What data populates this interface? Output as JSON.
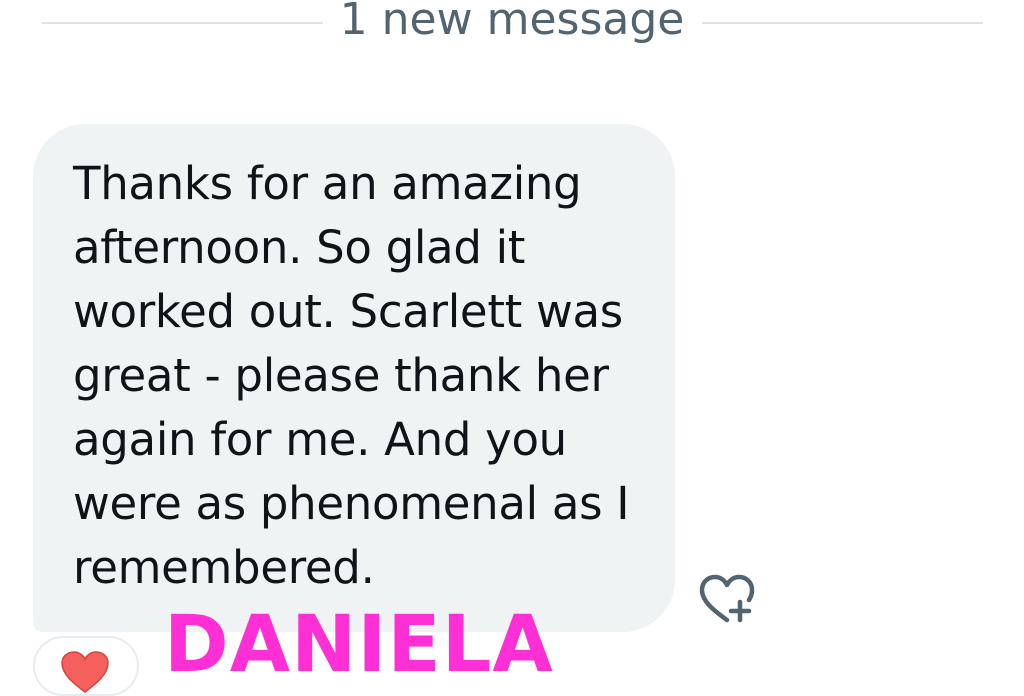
{
  "divider": {
    "label": "1 new message"
  },
  "message": {
    "text": "Thanks for an amazing afternoon. So glad it worked out. Scarlett was great - please thank her again for me. And you were as phenomenal as I remembered."
  },
  "watermark": {
    "text": "DANIELA"
  },
  "reaction": {
    "emoji_icon": "red-heart-icon",
    "add_icon": "heart-plus-icon"
  },
  "colors": {
    "bubble_bg": "#eff3f4",
    "text": "#0f1419",
    "muted": "#536471",
    "watermark": "#ff2fd6",
    "divider": "#dfe3e6"
  }
}
